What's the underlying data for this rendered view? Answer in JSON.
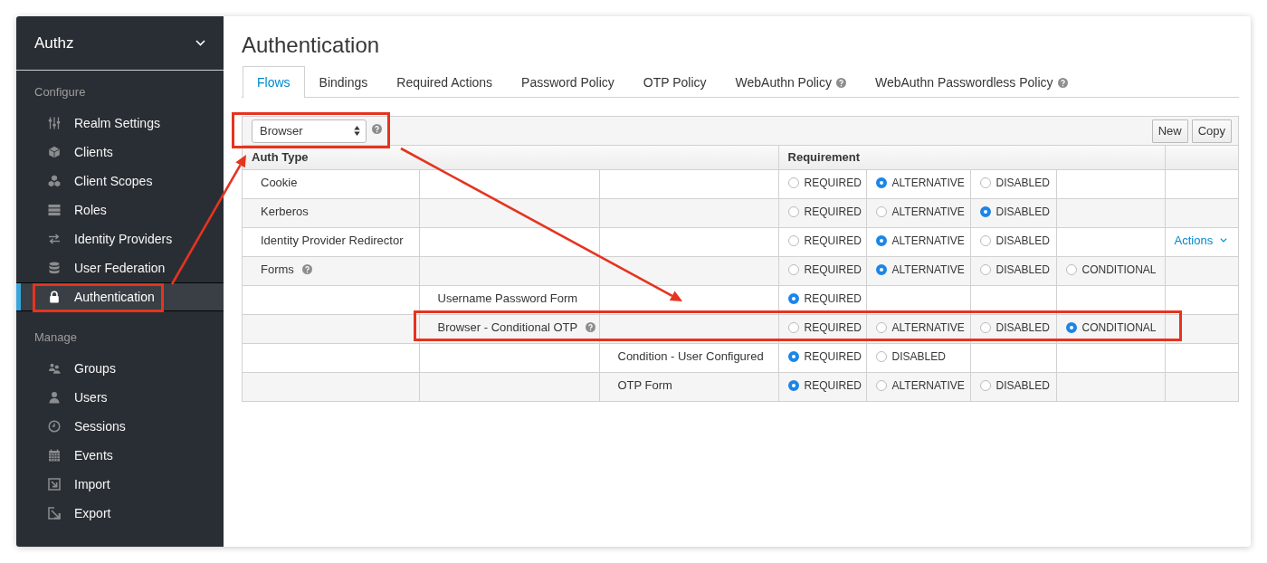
{
  "sidebar": {
    "realm": "Authz",
    "sections": [
      {
        "heading": "Configure",
        "items": [
          {
            "label": "Realm Settings",
            "selected": false,
            "highlighted": false
          },
          {
            "label": "Clients",
            "selected": false,
            "highlighted": false
          },
          {
            "label": "Client Scopes",
            "selected": false,
            "highlighted": false
          },
          {
            "label": "Roles",
            "selected": false,
            "highlighted": false
          },
          {
            "label": "Identity Providers",
            "selected": false,
            "highlighted": false
          },
          {
            "label": "User Federation",
            "selected": false,
            "highlighted": false
          },
          {
            "label": "Authentication",
            "selected": true,
            "highlighted": true
          }
        ]
      },
      {
        "heading": "Manage",
        "items": [
          {
            "label": "Groups",
            "selected": false,
            "highlighted": false
          },
          {
            "label": "Users",
            "selected": false,
            "highlighted": false
          },
          {
            "label": "Sessions",
            "selected": false,
            "highlighted": false
          },
          {
            "label": "Events",
            "selected": false,
            "highlighted": false
          },
          {
            "label": "Import",
            "selected": false,
            "highlighted": false
          },
          {
            "label": "Export",
            "selected": false,
            "highlighted": false
          }
        ]
      }
    ]
  },
  "page": {
    "title": "Authentication"
  },
  "tabs": [
    {
      "label": "Flows",
      "selected": true,
      "help": false
    },
    {
      "label": "Bindings",
      "selected": false,
      "help": false
    },
    {
      "label": "Required Actions",
      "selected": false,
      "help": false
    },
    {
      "label": "Password Policy",
      "selected": false,
      "help": false
    },
    {
      "label": "OTP Policy",
      "selected": false,
      "help": false
    },
    {
      "label": "WebAuthn Policy",
      "selected": false,
      "help": true
    },
    {
      "label": "WebAuthn Passwordless Policy",
      "selected": false,
      "help": true
    }
  ],
  "flow_select": {
    "value": "Browser",
    "help": true,
    "highlighted": true
  },
  "toolbar_buttons": [
    "New",
    "Copy"
  ],
  "table": {
    "columns": [
      "Auth Type",
      "Requirement"
    ],
    "rows": [
      {
        "name": "Cookie",
        "help": false,
        "highlighted": false,
        "options": [
          {
            "label": "REQUIRED",
            "selected": false
          },
          {
            "label": "ALTERNATIVE",
            "selected": true
          },
          {
            "label": "DISABLED",
            "selected": false
          }
        ]
      },
      {
        "name": "Kerberos",
        "help": false,
        "highlighted": false,
        "options": [
          {
            "label": "REQUIRED",
            "selected": false
          },
          {
            "label": "ALTERNATIVE",
            "selected": false
          },
          {
            "label": "DISABLED",
            "selected": true
          }
        ]
      },
      {
        "name": "Identity Provider Redirector",
        "help": false,
        "highlighted": false,
        "options": [
          {
            "label": "REQUIRED",
            "selected": false
          },
          {
            "label": "ALTERNATIVE",
            "selected": true
          },
          {
            "label": "DISABLED",
            "selected": false
          }
        ],
        "actions": "Actions"
      },
      {
        "name": "Forms",
        "help": true,
        "highlighted": false,
        "options": [
          {
            "label": "REQUIRED",
            "selected": false
          },
          {
            "label": "ALTERNATIVE",
            "selected": true
          },
          {
            "label": "DISABLED",
            "selected": false
          },
          {
            "label": "CONDITIONAL",
            "selected": false
          }
        ],
        "children": [
          {
            "name": "Username Password Form",
            "help": false,
            "highlighted": false,
            "options": [
              {
                "label": "REQUIRED",
                "selected": true
              }
            ]
          },
          {
            "name": "Browser - Conditional OTP",
            "help": true,
            "highlighted": true,
            "options": [
              {
                "label": "REQUIRED",
                "selected": false
              },
              {
                "label": "ALTERNATIVE",
                "selected": false
              },
              {
                "label": "DISABLED",
                "selected": false
              },
              {
                "label": "CONDITIONAL",
                "selected": true
              }
            ],
            "children": [
              {
                "name": "Condition - User Configured",
                "help": false,
                "highlighted": false,
                "options": [
                  {
                    "label": "REQUIRED",
                    "selected": true
                  },
                  {
                    "label": "DISABLED",
                    "selected": false
                  }
                ]
              },
              {
                "name": "OTP Form",
                "help": false,
                "highlighted": false,
                "options": [
                  {
                    "label": "REQUIRED",
                    "selected": true
                  },
                  {
                    "label": "ALTERNATIVE",
                    "selected": false
                  },
                  {
                    "label": "DISABLED",
                    "selected": false
                  }
                ]
              }
            ]
          }
        ]
      }
    ]
  }
}
